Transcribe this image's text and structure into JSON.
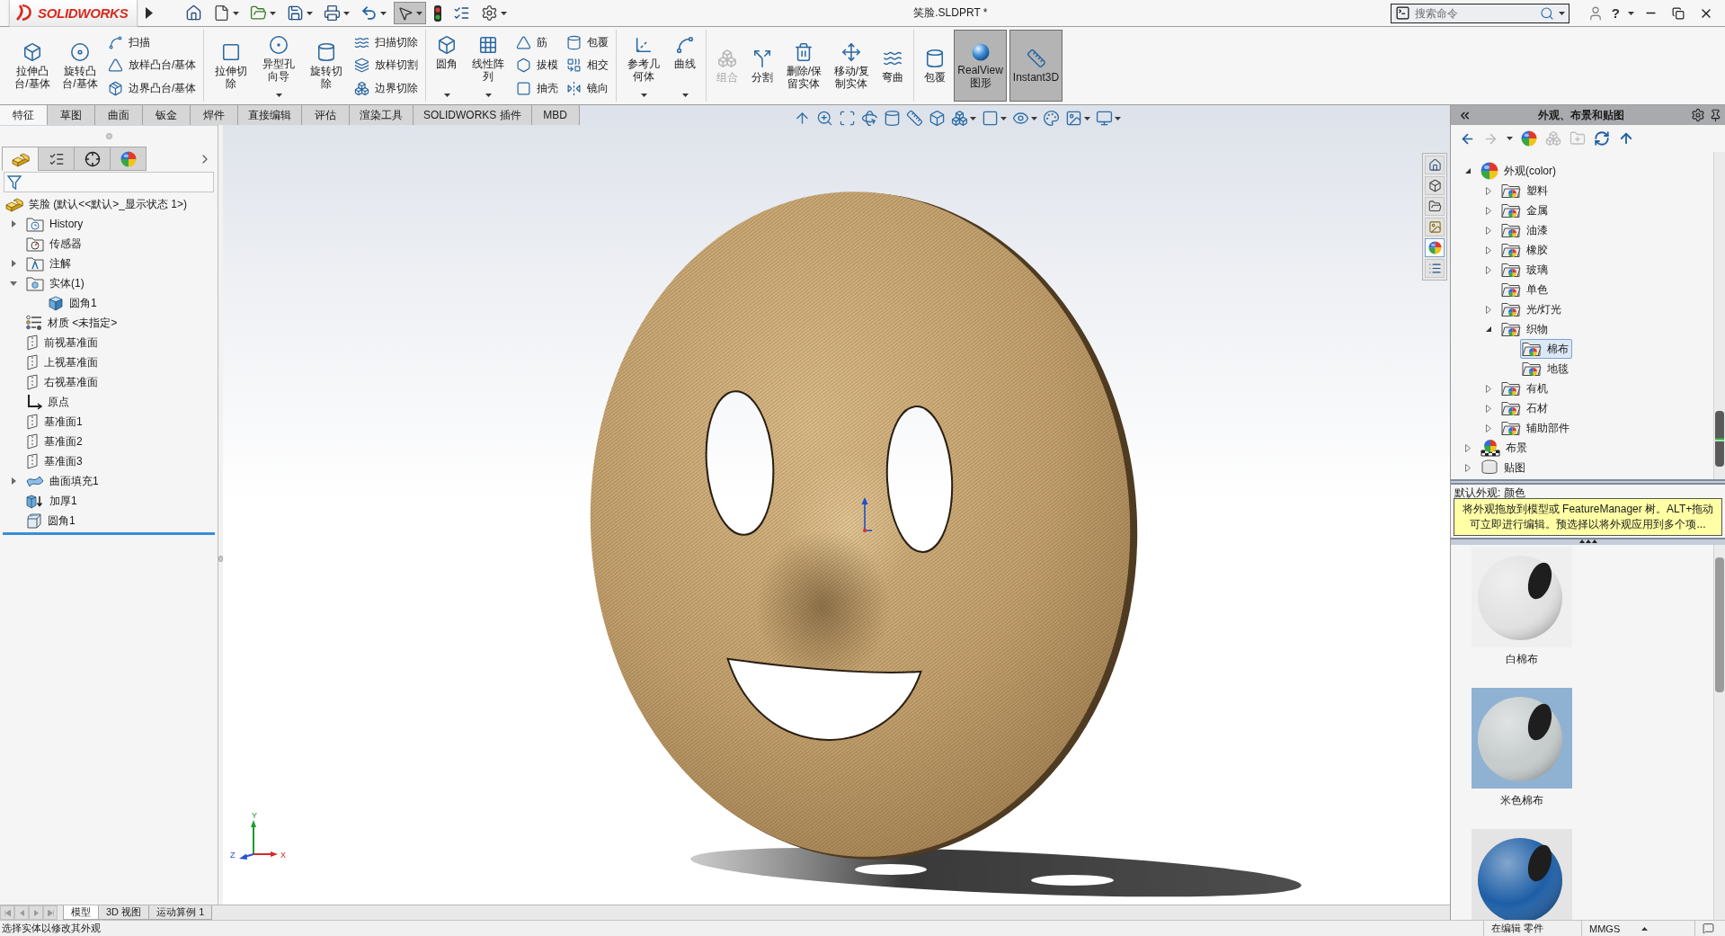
{
  "title_bar": {
    "logo": "SOLIDWORKS",
    "title": "笑脸.SLDPRT *",
    "search": {
      "placeholder": "搜索命令"
    },
    "help": "?"
  },
  "quick_access": [
    {
      "kind": "home",
      "caret": false,
      "pressed": false
    },
    {
      "kind": "new",
      "caret": true,
      "pressed": false
    },
    {
      "kind": "open",
      "caret": true,
      "pressed": false
    },
    {
      "kind": "save",
      "caret": true,
      "pressed": false
    },
    {
      "kind": "print",
      "caret": true,
      "pressed": false
    },
    {
      "kind": "undo",
      "caret": true,
      "pressed": false
    },
    {
      "kind": "select",
      "caret": true,
      "pressed": true
    },
    {
      "kind": "rebuild",
      "caret": false,
      "pressed": false
    },
    {
      "kind": "file_properties",
      "caret": false,
      "pressed": false
    },
    {
      "kind": "options",
      "caret": true,
      "pressed": false
    }
  ],
  "ribbon": {
    "groups": [
      {
        "items": [
          {
            "kind": "large",
            "label": "拉伸凸台/基体",
            "caret": false,
            "disabled": false,
            "pressed": false
          },
          {
            "kind": "large",
            "label": "旋转凸台/基体",
            "caret": false,
            "disabled": false,
            "pressed": false
          },
          {
            "kind": "stack",
            "labels": [
              "扫描",
              "放样凸台/基体",
              "边界凸台/基体"
            ]
          }
        ]
      },
      {
        "items": [
          {
            "kind": "large",
            "label": "拉伸切除",
            "caret": false,
            "disabled": false,
            "pressed": false
          },
          {
            "kind": "large",
            "label": "异型孔向导",
            "caret": true,
            "disabled": false,
            "pressed": false
          },
          {
            "kind": "large",
            "label": "旋转切除",
            "caret": false,
            "disabled": false,
            "pressed": false
          },
          {
            "kind": "stack",
            "labels": [
              "扫描切除",
              "放样切割",
              "边界切除"
            ]
          }
        ]
      },
      {
        "items": [
          {
            "kind": "large",
            "label": "圆角",
            "caret": true,
            "disabled": false,
            "pressed": false
          },
          {
            "kind": "large",
            "label": "线性阵列",
            "caret": true,
            "disabled": false,
            "pressed": false
          },
          {
            "kind": "stack",
            "labels": [
              "筋",
              "拔模",
              "抽壳"
            ]
          },
          {
            "kind": "stack",
            "labels": [
              "包覆",
              "相交",
              "镜向"
            ]
          }
        ]
      },
      {
        "items": [
          {
            "kind": "large",
            "label": "参考几何体",
            "caret": true,
            "disabled": false,
            "pressed": false
          },
          {
            "kind": "large",
            "label": "曲线",
            "caret": true,
            "disabled": false,
            "pressed": false
          }
        ]
      },
      {
        "items": [
          {
            "kind": "large",
            "label": "组合",
            "caret": false,
            "disabled": true,
            "pressed": false
          },
          {
            "kind": "large",
            "label": "分割",
            "caret": false,
            "disabled": false,
            "pressed": false
          },
          {
            "kind": "large",
            "label": "删除/保留实体",
            "caret": false,
            "disabled": false,
            "pressed": false
          },
          {
            "kind": "large",
            "label": "移动/复制实体",
            "caret": false,
            "disabled": false,
            "pressed": false
          },
          {
            "kind": "large",
            "label": "弯曲",
            "caret": false,
            "disabled": false,
            "pressed": false
          }
        ]
      },
      {
        "items": [
          {
            "kind": "large",
            "label": "包覆",
            "caret": false,
            "disabled": false,
            "pressed": false
          },
          {
            "kind": "large",
            "label": "RealView图形",
            "caret": false,
            "disabled": false,
            "pressed": true
          },
          {
            "kind": "large",
            "label": "Instant3D",
            "caret": false,
            "disabled": false,
            "pressed": true
          }
        ]
      }
    ]
  },
  "command_tabs": [
    {
      "label": "特征",
      "selected": true
    },
    {
      "label": "草图",
      "selected": false
    },
    {
      "label": "曲面",
      "selected": false
    },
    {
      "label": "钣金",
      "selected": false
    },
    {
      "label": "焊件",
      "selected": false
    },
    {
      "label": "直接编辑",
      "selected": false
    },
    {
      "label": "评估",
      "selected": false
    },
    {
      "label": "渲染工具",
      "selected": false
    },
    {
      "label": "SOLIDWORKS 插件",
      "selected": false
    },
    {
      "label": "MBD",
      "selected": false
    }
  ],
  "feature_manager": {
    "panel_tabs": [
      {
        "kind": "feature_tree",
        "selected": true
      },
      {
        "kind": "property_manager",
        "selected": false
      },
      {
        "kind": "configuration",
        "selected": false
      },
      {
        "kind": "display",
        "selected": false
      }
    ],
    "tree": [
      {
        "kind": "part",
        "label": "笑脸 (默认<<默认>_显示状态 1>)",
        "children": [
          {
            "kind": "history",
            "label": "History",
            "expanded": false
          },
          {
            "kind": "sensors",
            "label": "传感器"
          },
          {
            "kind": "annotations",
            "label": "注解",
            "expanded": false
          },
          {
            "kind": "solid_bodies",
            "label": "实体(1)",
            "expanded": true,
            "children": [
              {
                "kind": "body",
                "label": "圆角1"
              }
            ]
          },
          {
            "kind": "material",
            "label": "材质 <未指定>"
          },
          {
            "kind": "plane",
            "label": "前视基准面"
          },
          {
            "kind": "plane",
            "label": "上视基准面"
          },
          {
            "kind": "plane",
            "label": "右视基准面"
          },
          {
            "kind": "origin",
            "label": "原点"
          },
          {
            "kind": "plane",
            "label": "基准面1"
          },
          {
            "kind": "plane",
            "label": "基准面2"
          },
          {
            "kind": "plane",
            "label": "基准面3"
          },
          {
            "kind": "fill_surface",
            "label": "曲面填充1",
            "expanded": false
          },
          {
            "kind": "thicken",
            "label": "加厚1"
          },
          {
            "kind": "fillet",
            "label": "圆角1"
          }
        ]
      }
    ]
  },
  "view_toolbar": [
    {
      "caret": false
    },
    {
      "caret": false
    },
    {
      "caret": false
    },
    {
      "caret": false
    },
    {
      "caret": false
    },
    {
      "caret": false
    },
    {
      "caret": false
    },
    {
      "caret": true
    },
    {
      "caret": true
    },
    {
      "caret": true
    },
    {
      "caret": false
    },
    {
      "caret": true
    },
    {
      "caret": true
    }
  ],
  "triad": {
    "y": "Y",
    "z": "Z",
    "x": "X"
  },
  "task_pane_tabs": [
    {
      "kind": "resources",
      "selected": false
    },
    {
      "kind": "design_library",
      "selected": false
    },
    {
      "kind": "file_explorer",
      "selected": false
    },
    {
      "kind": "view_palette",
      "selected": false
    },
    {
      "kind": "appearances",
      "selected": true
    },
    {
      "kind": "custom_properties",
      "selected": false
    }
  ],
  "bottom_tabs": [
    {
      "label": "模型",
      "selected": true
    },
    {
      "label": "3D 视图",
      "selected": false
    },
    {
      "label": "运动算例 1",
      "selected": false
    }
  ],
  "appearance_panel": {
    "title": "外观、布景和贴图",
    "toolbar": [
      {
        "kind": "back",
        "disabled": false
      },
      {
        "kind": "forward",
        "disabled": true
      },
      {
        "kind": "history",
        "disabled": false
      },
      {
        "kind": "edit_appearance",
        "disabled": false
      },
      {
        "kind": "add",
        "disabled": true
      },
      {
        "kind": "new_folder",
        "disabled": true
      },
      {
        "kind": "refresh",
        "disabled": false
      },
      {
        "kind": "up",
        "disabled": false
      }
    ],
    "tree": [
      {
        "kind": "appearances",
        "label": "外观(color)",
        "expanded": true,
        "selected": false,
        "children": [
          {
            "kind": "folder",
            "label": "塑料",
            "expanded": false,
            "selected": false
          },
          {
            "kind": "folder",
            "label": "金属",
            "expanded": false,
            "selected": false
          },
          {
            "kind": "folder",
            "label": "油漆",
            "expanded": false,
            "selected": false
          },
          {
            "kind": "folder",
            "label": "橡胶",
            "expanded": false,
            "selected": false
          },
          {
            "kind": "folder",
            "label": "玻璃",
            "expanded": false,
            "selected": false
          },
          {
            "kind": "folder",
            "label": "单色",
            "selected": false
          },
          {
            "kind": "folder",
            "label": "光/灯光",
            "expanded": false,
            "selected": false
          },
          {
            "kind": "folder",
            "label": "织物",
            "expanded": true,
            "selected": false,
            "children": [
              {
                "kind": "folder",
                "label": "棉布",
                "selected": true
              },
              {
                "kind": "folder",
                "label": "地毯",
                "selected": false
              }
            ]
          },
          {
            "kind": "folder",
            "label": "有机",
            "expanded": false,
            "selected": false
          },
          {
            "kind": "folder",
            "label": "石材",
            "expanded": false,
            "selected": false
          },
          {
            "kind": "folder",
            "label": "辅助部件",
            "expanded": false,
            "selected": false
          }
        ]
      },
      {
        "kind": "scenes",
        "label": "布景",
        "expanded": false,
        "selected": false
      },
      {
        "kind": "decals",
        "label": "贴图",
        "expanded": false,
        "selected": false
      }
    ],
    "info": "默认外观: 颜色",
    "hint": "将外观拖放到模型或 FeatureManager 树。ALT+拖动可立即进行编辑。预选择以将外观应用到多个项...",
    "materials": [
      {
        "label": "白棉布",
        "color": "#e2e2e2"
      },
      {
        "label": "米色棉布",
        "color": "#c6cccc"
      },
      {
        "color": "#1d5ea6"
      }
    ]
  },
  "status_bar": {
    "message": "选择实体以修改其外观",
    "mode": "在编辑 零件",
    "units": "MMGS"
  }
}
